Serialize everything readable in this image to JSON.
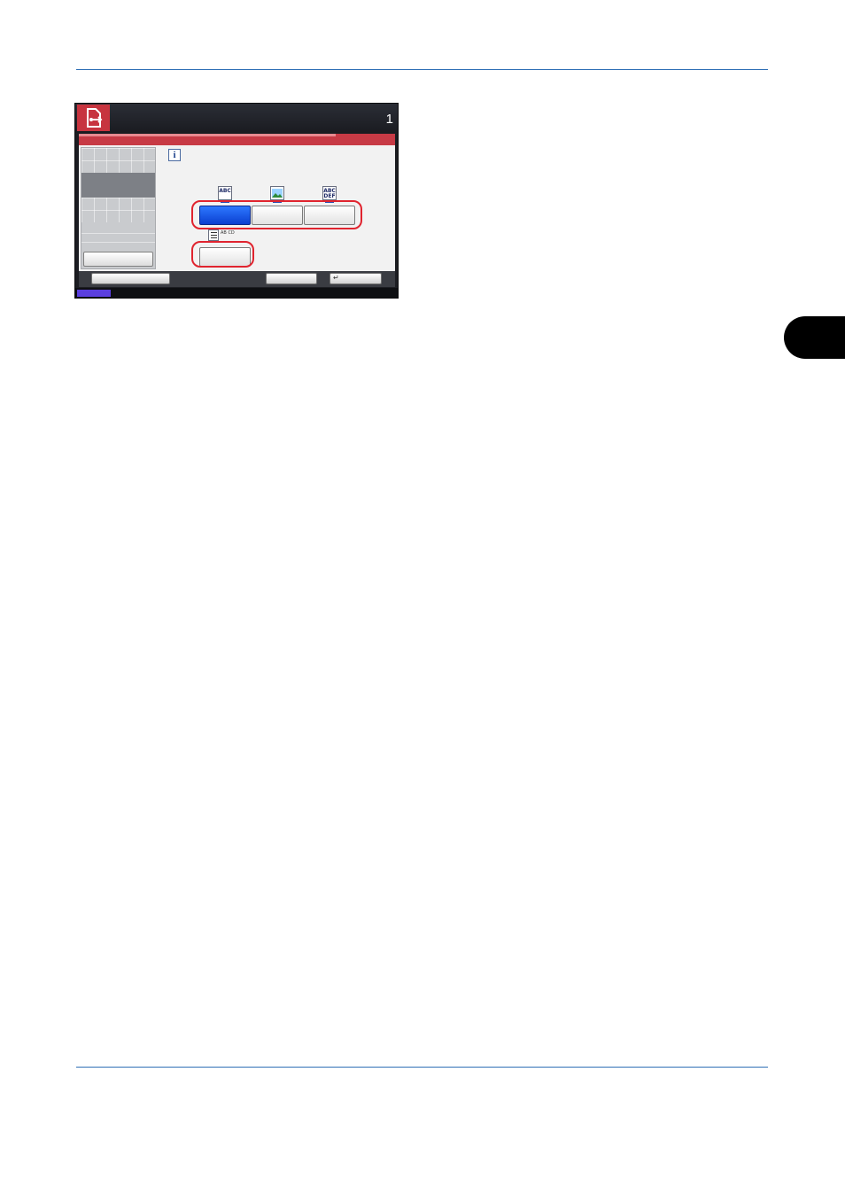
{
  "panel": {
    "header": {
      "mode_icon": "send-document-icon",
      "counter": "1"
    },
    "title_bar": "",
    "left_menu": {
      "button_label": ""
    },
    "info_icon": "info-icon",
    "options_row1": [
      {
        "icon": "text-photo-icon",
        "label": "",
        "selected": true
      },
      {
        "icon": "photo-icon",
        "label": "",
        "selected": false
      },
      {
        "icon": "text-icon",
        "label": "",
        "selected": false
      }
    ],
    "options_row2": [
      {
        "icon": "ocr-text-icon",
        "icon_caption": "AB CD",
        "label": "",
        "selected": false
      }
    ],
    "footer": {
      "left_button": "",
      "middle_button": "",
      "return_button_icon": "return-arrow-icon"
    }
  },
  "colors": {
    "accent_red": "#c73a45",
    "selected_blue": "#1a5cf0",
    "highlight_red": "#e0242f",
    "rule_blue": "#2f6fb6"
  }
}
